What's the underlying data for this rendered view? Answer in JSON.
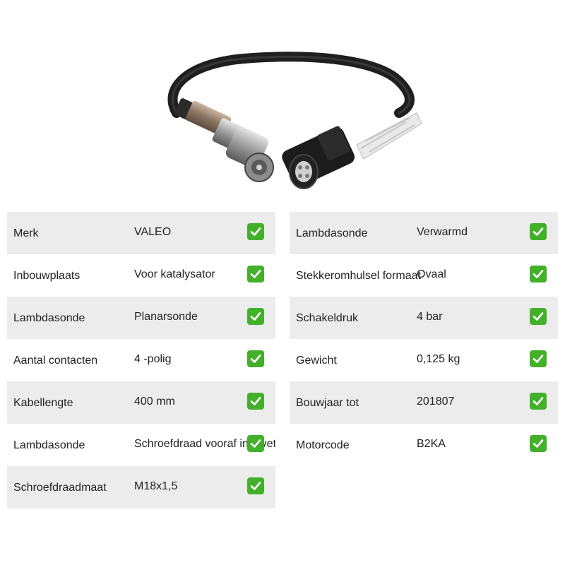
{
  "colors": {
    "row_shade": "#ececec",
    "check_green": "#43b02a"
  },
  "image": {
    "icon": "lambda-sensor-product-image"
  },
  "specs_left": [
    {
      "label": "Merk",
      "value": "VALEO"
    },
    {
      "label": "Inbouwplaats",
      "value": "Voor katalysator"
    },
    {
      "label": "Lambdasonde",
      "value": "Planarsonde"
    },
    {
      "label": "Aantal contacten",
      "value": "4 -polig"
    },
    {
      "label": "Kabellengte",
      "value": "400 mm"
    },
    {
      "label": "Lambdasonde",
      "value": "Schroefdraad vooraf ingevet"
    },
    {
      "label": "Schroefdraadmaat",
      "value": "M18x1,5"
    }
  ],
  "specs_right": [
    {
      "label": "Lambdasonde",
      "value": "Verwarmd"
    },
    {
      "label": "Stekkeromhulsel formaat",
      "value": "Ovaal"
    },
    {
      "label": "Schakeldruk",
      "value": "4 bar"
    },
    {
      "label": "Gewicht",
      "value": "0,125 kg"
    },
    {
      "label": "Bouwjaar tot",
      "value": "201807"
    },
    {
      "label": "Motorcode",
      "value": "B2KA"
    }
  ],
  "check_icon": "checkmark-icon"
}
